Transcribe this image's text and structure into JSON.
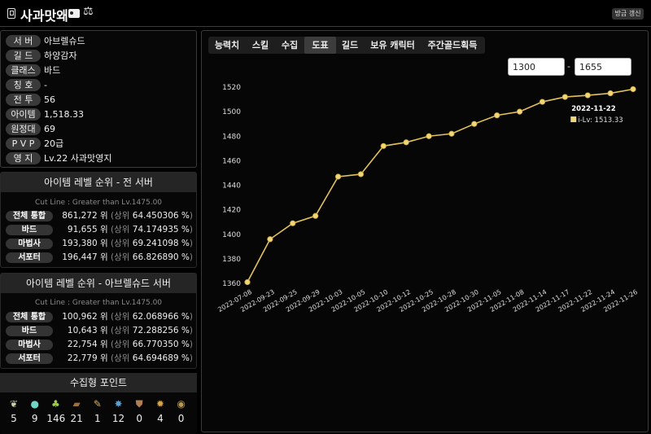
{
  "header": {
    "title": "사과맛왜",
    "refresh_label": "방금 갱신"
  },
  "info": [
    {
      "label": "서 버",
      "value": "아브렐슈드"
    },
    {
      "label": "길 드",
      "value": "하양감자"
    },
    {
      "label": "클래스",
      "value": "바드"
    },
    {
      "label": "칭 호",
      "value": "-"
    },
    {
      "label": "전 투",
      "value": "56"
    },
    {
      "label": "아이템",
      "value": "1,518.33"
    },
    {
      "label": "원정대",
      "value": "69"
    },
    {
      "label": "P V P",
      "value": "20급"
    },
    {
      "label": "영 지",
      "value": "Lv.22 사과맛영지"
    }
  ],
  "rank_all": {
    "title": "아이템 레벨 순위 - 전 서버",
    "cutline": "Cut Line : Greater than Lv.1475.00",
    "rows": [
      {
        "label": "전체 통합",
        "rank": "861,272 위",
        "pct": "64.450306 %"
      },
      {
        "label": "바드",
        "rank": "91,655 위",
        "pct": "74.174935 %"
      },
      {
        "label": "마법사",
        "rank": "193,380 위",
        "pct": "69.241098 %"
      },
      {
        "label": "서포터",
        "rank": "196,447 위",
        "pct": "66.826890 %"
      }
    ]
  },
  "rank_server": {
    "title": "아이템 레벨 순위 - 아브렐슈드 서버",
    "cutline": "Cut Line : Greater than Lv.1475.00",
    "rows": [
      {
        "label": "전체 통합",
        "rank": "100,962 위",
        "pct": "62.068966 %"
      },
      {
        "label": "바드",
        "rank": "10,643 위",
        "pct": "72.288256 %"
      },
      {
        "label": "마법사",
        "rank": "22,754 위",
        "pct": "66.770350 %"
      },
      {
        "label": "서포터",
        "rank": "22,779 위",
        "pct": "64.694689 %"
      }
    ]
  },
  "rank_prefix": "(상위",
  "rank_suffix": ")",
  "collect": {
    "title": "수집형 포인트",
    "items": [
      {
        "icon": "mokoko-seed-icon",
        "count": "5",
        "glyph": "❦",
        "color": "#c9d6a8"
      },
      {
        "icon": "island-heart-icon",
        "count": "9",
        "glyph": "●",
        "color": "#6fd6c7"
      },
      {
        "icon": "giant-heart-icon",
        "count": "146",
        "glyph": "♣",
        "color": "#9bcc4a"
      },
      {
        "icon": "art-painting-icon",
        "count": "21",
        "glyph": "▰",
        "color": "#a0703a"
      },
      {
        "icon": "voyage-compass-icon",
        "count": "1",
        "glyph": "✎",
        "color": "#d7b060"
      },
      {
        "icon": "ignea-token-icon",
        "count": "12",
        "glyph": "✸",
        "color": "#4aa3e0"
      },
      {
        "icon": "orpheus-star-icon",
        "count": "0",
        "glyph": "⛊",
        "color": "#b08050"
      },
      {
        "icon": "world-tree-leaf-icon",
        "count": "4",
        "glyph": "✹",
        "color": "#d9a441"
      },
      {
        "icon": "sea-bounty-icon",
        "count": "0",
        "glyph": "◉",
        "color": "#b59a5a"
      }
    ]
  },
  "tabs": [
    "능력치",
    "스킬",
    "수집",
    "도표",
    "길드",
    "보유 캐릭터",
    "주간골드획득"
  ],
  "active_tab": "도표",
  "range": {
    "min": "1300",
    "max": "1655",
    "separator": "-"
  },
  "chart_data": {
    "type": "line",
    "x": [
      "2022-07-08",
      "2022-09-23",
      "2022-09-25",
      "2022-09-29",
      "2022-10-03",
      "2022-10-05",
      "2022-10-10",
      "2022-10-12",
      "2022-10-25",
      "2022-10-28",
      "2022-10-30",
      "2022-11-05",
      "2022-11-08",
      "2022-11-14",
      "2022-11-17",
      "2022-11-22",
      "2022-11-24",
      "2022-11-26"
    ],
    "series": [
      {
        "name": "i-Lv",
        "values": [
          1361,
          1396,
          1409,
          1415,
          1447,
          1449,
          1472,
          1475,
          1480,
          1482,
          1490,
          1497,
          1500,
          1508,
          1512,
          1513.33,
          1515,
          1518.33
        ]
      }
    ],
    "ylim": [
      1360,
      1520
    ],
    "yticks": [
      1360,
      1380,
      1400,
      1420,
      1440,
      1460,
      1480,
      1500,
      1520
    ],
    "grid": false,
    "line_color": "#e2c257",
    "tooltip": {
      "title": "2022-11-22",
      "text": "i-Lv: 1513.33",
      "index": 15
    }
  }
}
